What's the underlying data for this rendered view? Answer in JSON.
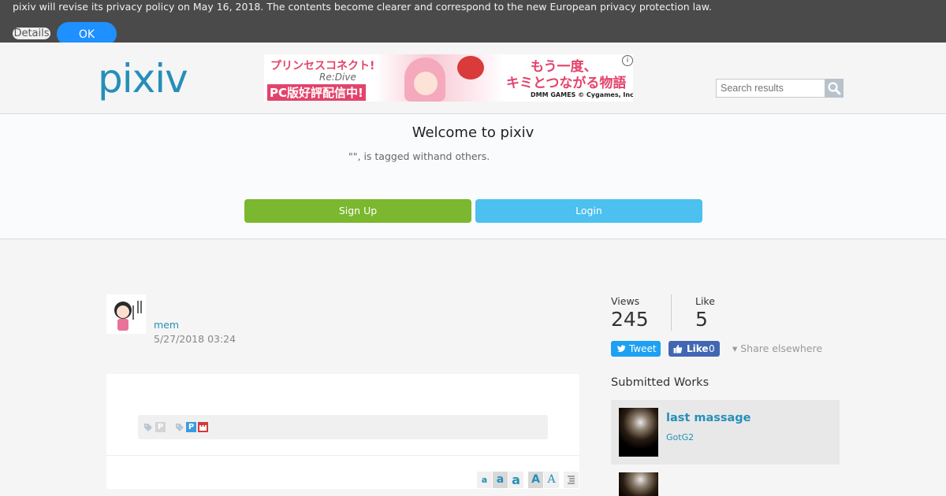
{
  "privacy_banner": {
    "text": "pixiv will revise its privacy policy on May 16, 2018. The contents become clearer and correspond to the new European privacy protection law.",
    "details_label": "Details",
    "ok_label": "OK"
  },
  "header": {
    "logo_text": "pixiv",
    "search": {
      "placeholder": "Search results"
    },
    "ad": {
      "line1": "プリンセスコネクト!",
      "line2": "Re:Dive",
      "line3": "PC版好評配信中!",
      "line4": "もう一度、",
      "line5": "キミとつながる物語",
      "line6": "DMM GAMES  © Cygames, Inc.",
      "info_label": "i"
    }
  },
  "welcome": {
    "title": "Welcome to pixiv",
    "subtitle": "\"\", is tagged withand others.",
    "signup_label": "Sign Up",
    "login_label": "Login"
  },
  "post": {
    "author": "mem",
    "date": "5/27/2018 03:24",
    "tag_badges": [
      "P",
      "P"
    ],
    "font_controls": [
      "a",
      "a",
      "a",
      "A",
      "A"
    ]
  },
  "stats": {
    "views_label": "Views",
    "views_value": "245",
    "likes_label": "Like",
    "likes_value": "5",
    "tweet_label": "Tweet",
    "fb_label": "Like",
    "fb_count": "0",
    "share_label": "▾ Share elsewhere"
  },
  "submitted": {
    "title": "Submitted Works",
    "works": [
      {
        "title": "last massage",
        "author": "GotG2"
      }
    ]
  },
  "colors": {
    "accent_blue": "#258fb8",
    "signup_green": "#7bb72f",
    "login_blue": "#4cc0ee",
    "banner_bg": "#4a4a4a",
    "ok_blue": "#1e90ff"
  }
}
